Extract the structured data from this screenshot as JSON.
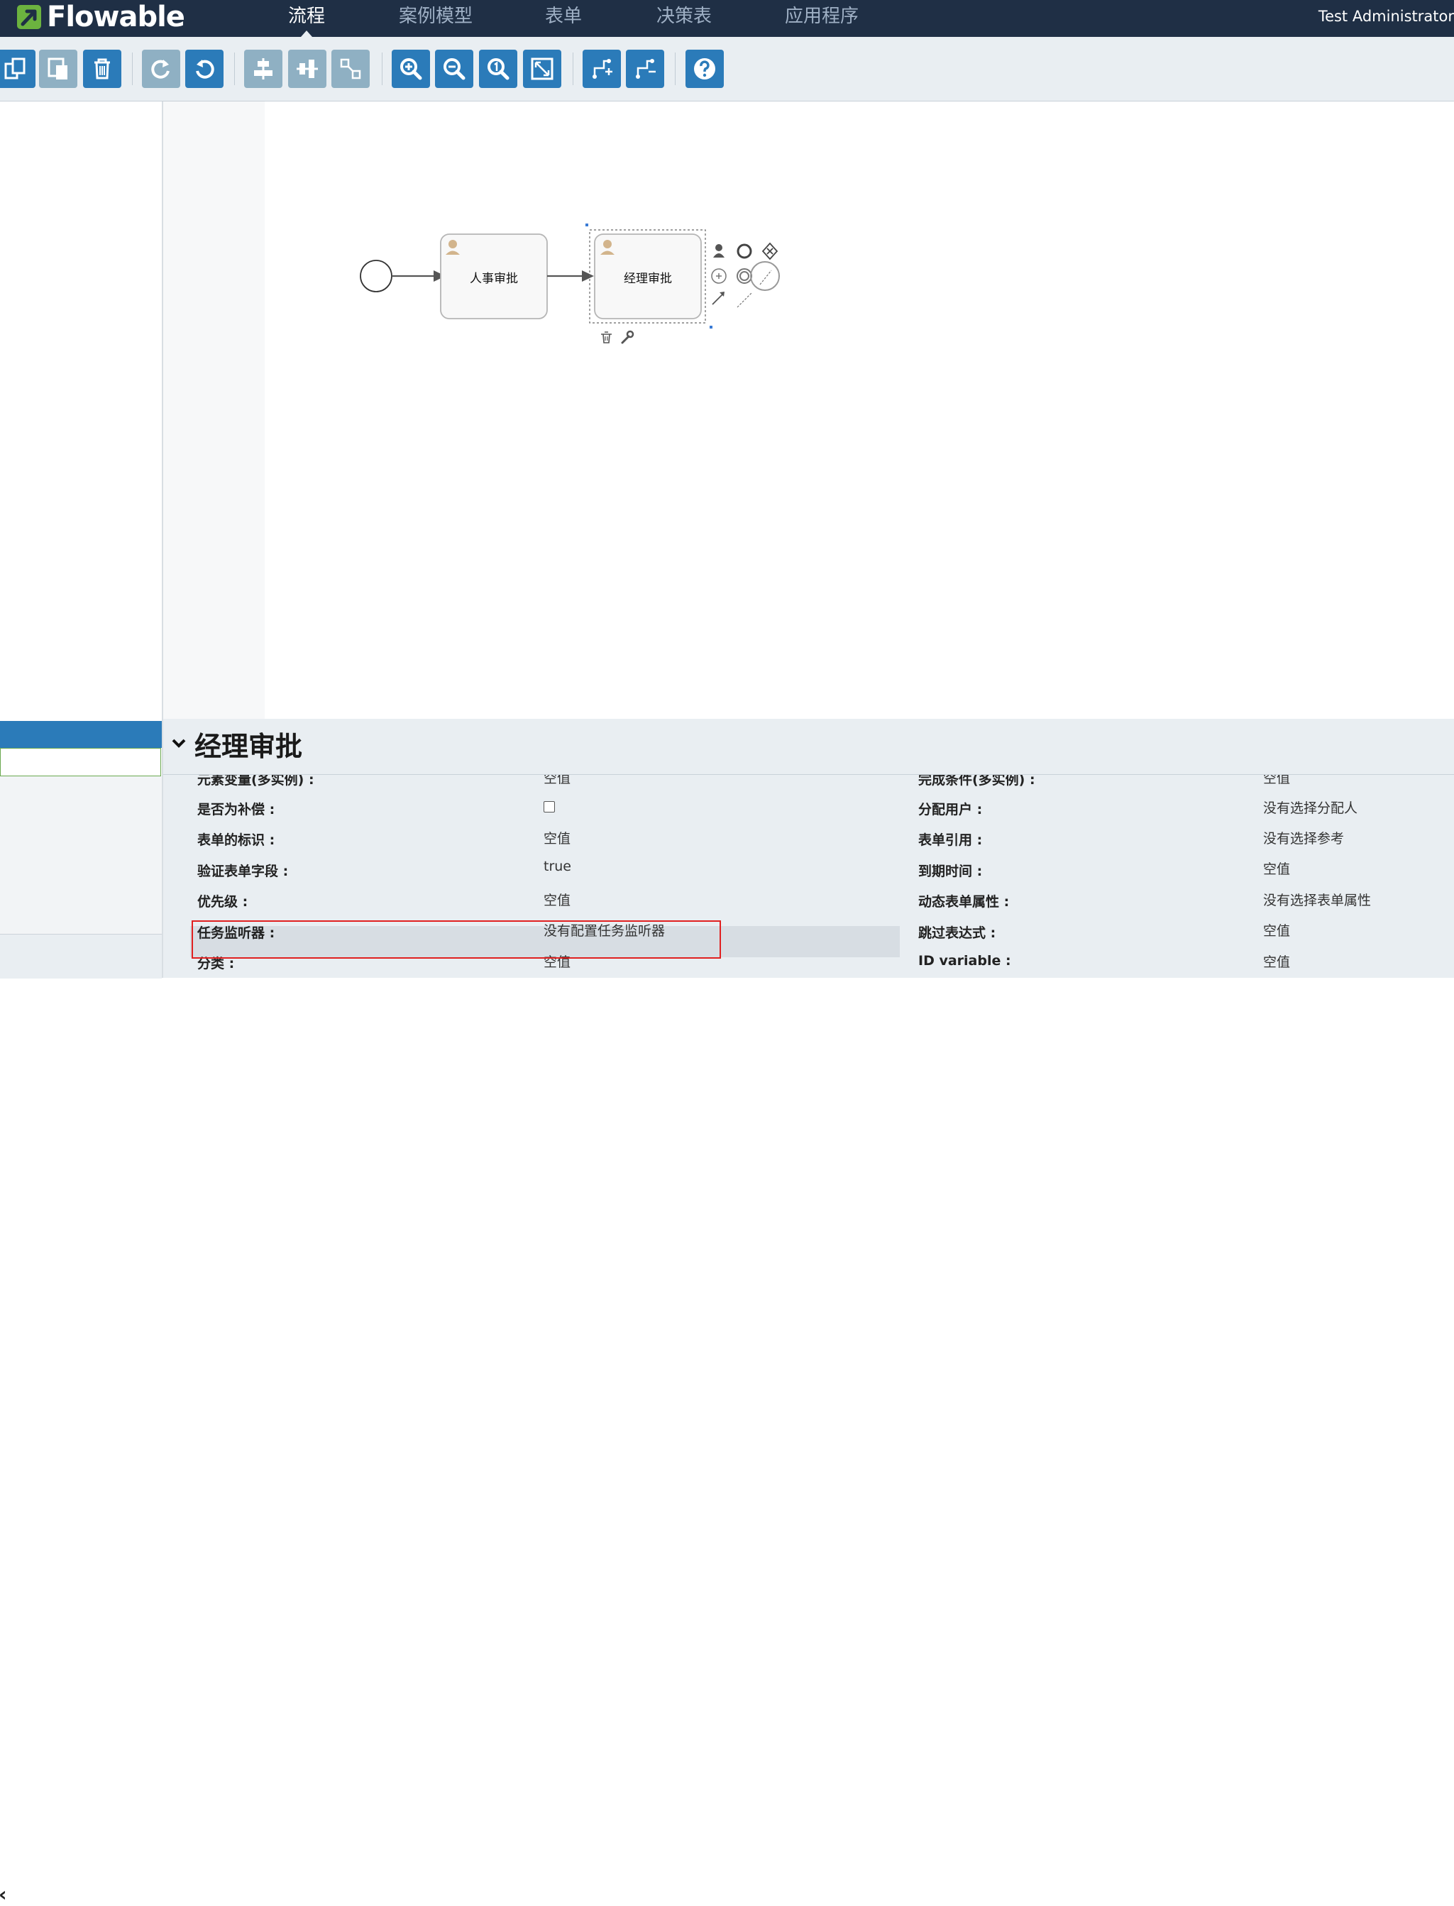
{
  "app": {
    "brand": "Flowable",
    "user": "Test Administrator"
  },
  "nav": {
    "items": [
      "流程",
      "案例模型",
      "表单",
      "决策表",
      "应用程序"
    ],
    "active_index": 0
  },
  "toolbar": {
    "buttons": [
      {
        "name": "copy-button",
        "icon": "copy-icon",
        "enabled": true
      },
      {
        "name": "paste-button",
        "icon": "paste-icon",
        "enabled": false
      },
      {
        "name": "delete-button",
        "icon": "trash-icon",
        "enabled": true
      },
      {
        "name": "redo-button",
        "icon": "redo-icon",
        "enabled": false
      },
      {
        "name": "undo-button",
        "icon": "undo-icon",
        "enabled": true
      },
      {
        "name": "align-horizontal-button",
        "icon": "align-horizontal-icon",
        "enabled": false
      },
      {
        "name": "align-vertical-button",
        "icon": "align-vertical-icon",
        "enabled": false
      },
      {
        "name": "same-size-button",
        "icon": "same-size-icon",
        "enabled": false
      },
      {
        "name": "zoom-in-button",
        "icon": "zoom-in-icon",
        "enabled": true
      },
      {
        "name": "zoom-out-button",
        "icon": "zoom-out-icon",
        "enabled": true
      },
      {
        "name": "zoom-actual-button",
        "icon": "zoom-actual-icon",
        "enabled": true
      },
      {
        "name": "zoom-fit-button",
        "icon": "zoom-fit-icon",
        "enabled": true
      },
      {
        "name": "add-bendpoint-button",
        "icon": "add-bendpoint-icon",
        "enabled": true
      },
      {
        "name": "remove-bendpoint-button",
        "icon": "remove-bendpoint-icon",
        "enabled": true
      },
      {
        "name": "help-button",
        "icon": "help-icon",
        "enabled": true
      }
    ]
  },
  "diagram": {
    "tasks": [
      "人事审批",
      "经理审批"
    ],
    "selected_task": "经理审批"
  },
  "properties": {
    "title": "经理审批",
    "left": [
      {
        "label": "元素变量(多实例) :",
        "value": "空值"
      },
      {
        "label": "是否为补偿 :",
        "value": "",
        "checkbox": true,
        "checked": false
      },
      {
        "label": "表单的标识 :",
        "value": "空值"
      },
      {
        "label": "验证表单字段 :",
        "value": "true"
      },
      {
        "label": "优先级 :",
        "value": "空值"
      },
      {
        "label": "任务监听器 :",
        "value": "没有配置任务监听器",
        "highlighted": true
      },
      {
        "label": "分类 :",
        "value": "空值"
      }
    ],
    "right": [
      {
        "label": "完成条件(多实例) :",
        "value": "空值"
      },
      {
        "label": "分配用户 :",
        "value": "没有选择分配人"
      },
      {
        "label": "表单引用 :",
        "value": "没有选择参考"
      },
      {
        "label": "到期时间 :",
        "value": "空值"
      },
      {
        "label": "动态表单属性 :",
        "value": "没有选择表单属性"
      },
      {
        "label": "跳过表达式 :",
        "value": "空值"
      },
      {
        "label": "ID variable :",
        "value": "空值"
      }
    ]
  },
  "colors": {
    "navbar": "#1f2f45",
    "accent": "#2b7bb9",
    "disabled": "#8fb0c3",
    "highlight_border": "#e02020",
    "brand_green": "#6cb33f"
  }
}
